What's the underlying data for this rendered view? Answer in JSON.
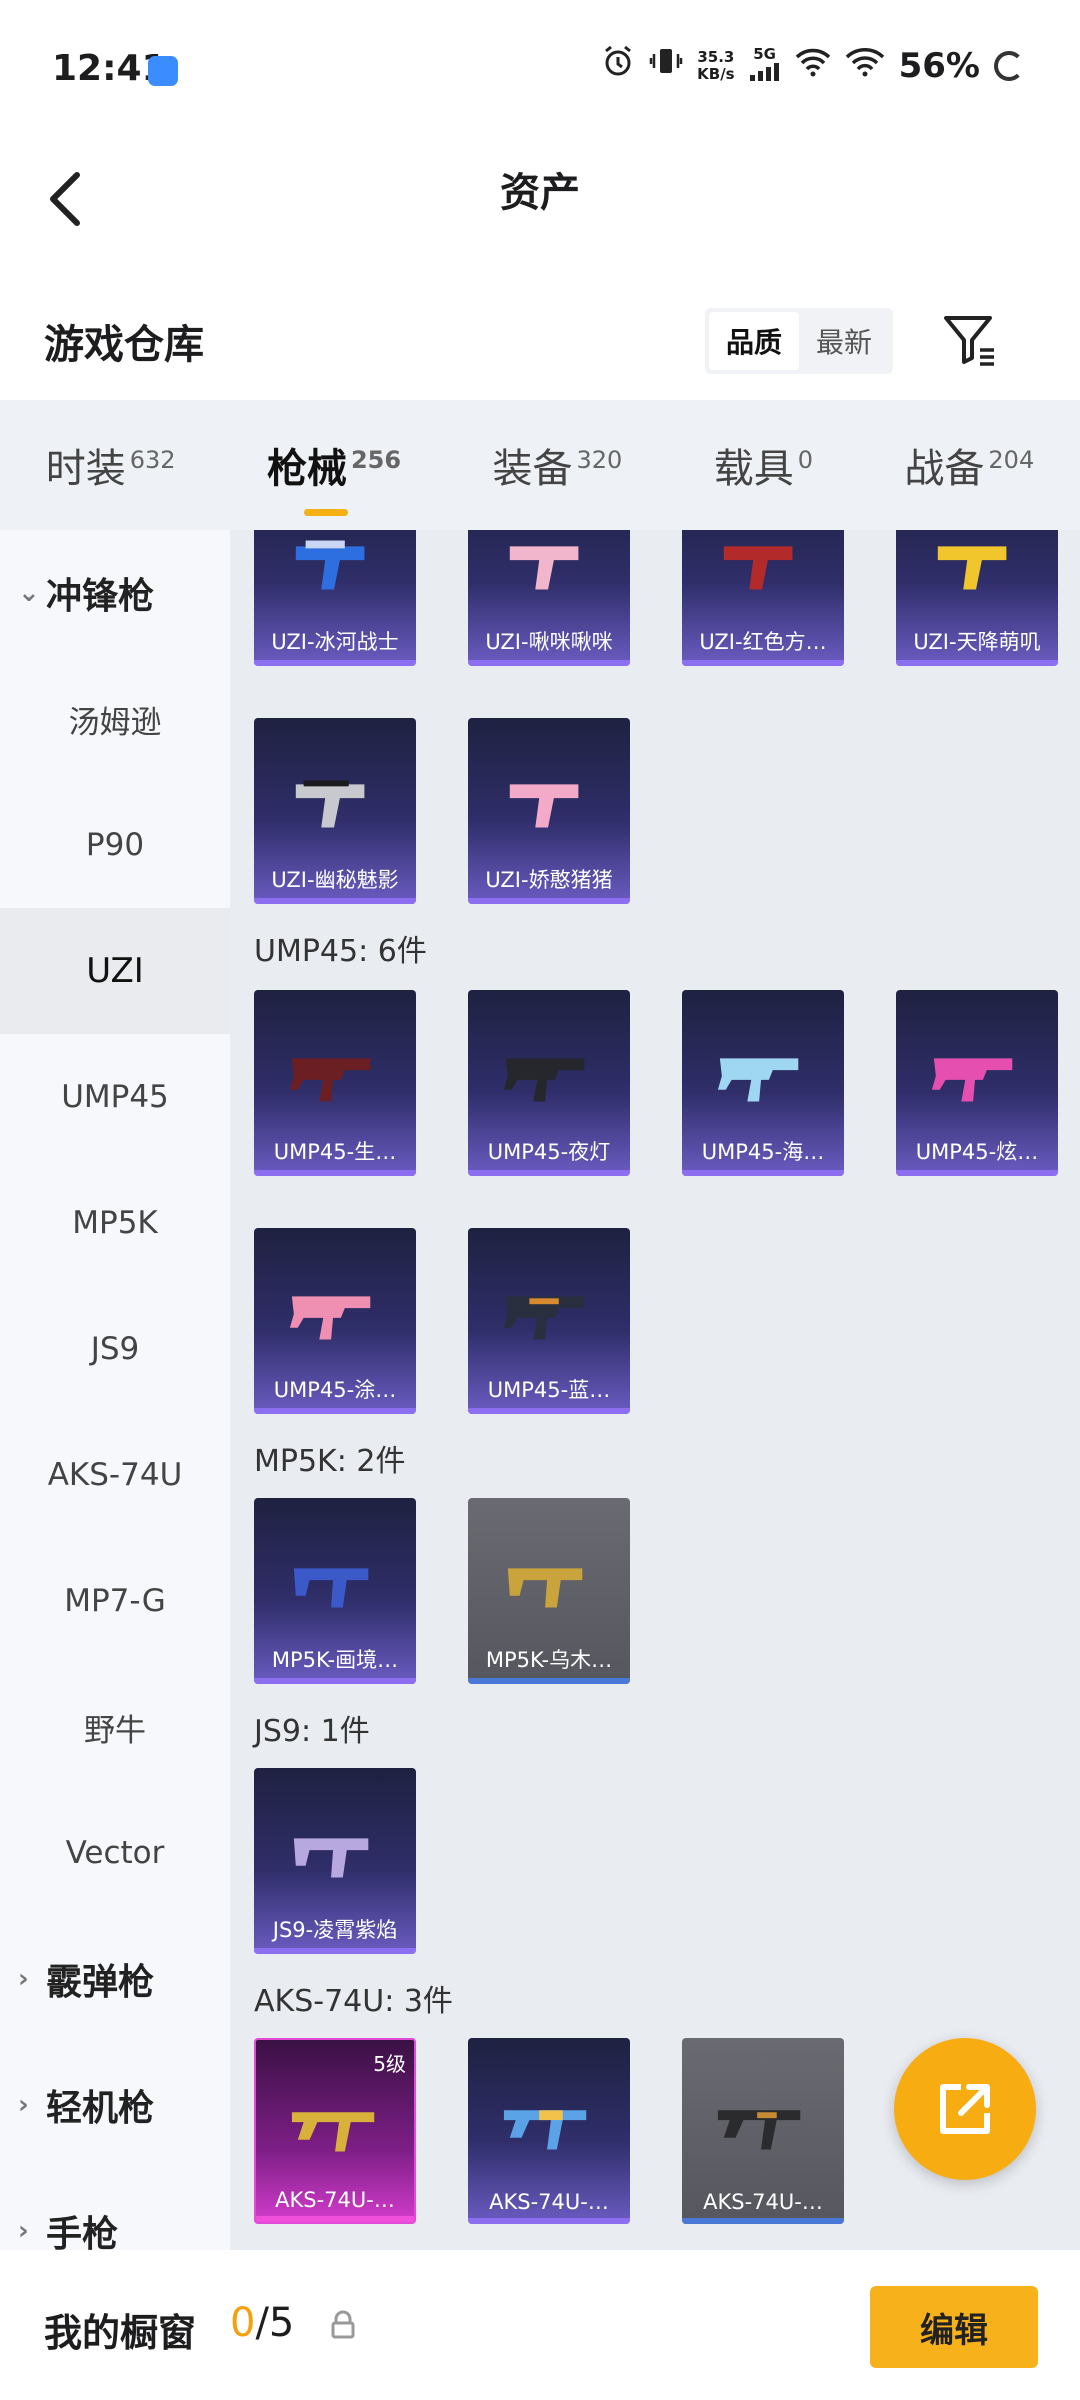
{
  "status_bar": {
    "time": "12:41",
    "net_speed_value": "35.3",
    "net_speed_unit": "KB/s",
    "network": "5G",
    "battery": "56%"
  },
  "nav": {
    "title": "资产"
  },
  "warehouse": {
    "title": "游戏仓库",
    "sort_quality": "品质",
    "sort_newest": "最新"
  },
  "category_tabs": [
    {
      "label": "时装",
      "count": "632"
    },
    {
      "label": "枪械",
      "count": "256"
    },
    {
      "label": "装备",
      "count": "320"
    },
    {
      "label": "载具",
      "count": "0"
    },
    {
      "label": "战备",
      "count": "204"
    }
  ],
  "sidebar": {
    "group_smg": "冲锋枪",
    "items": [
      "汤姆逊",
      "P90",
      "UZI",
      "UMP45",
      "MP5K",
      "JS9",
      "AKS-74U",
      "MP7-G",
      "野牛",
      "Vector"
    ],
    "group_shotgun": "霰弹枪",
    "group_lmg": "轻机枪",
    "group_pistol": "手枪"
  },
  "sections": {
    "uzi_cards": [
      "UZI-冰河战士",
      "UZI-啾咪啾咪",
      "UZI-红色方…",
      "UZI-天降萌叽",
      "UZI-幽秘魅影",
      "UZI-娇憨猪猪"
    ],
    "ump45_header": "UMP45: 6件",
    "ump45_cards": [
      "UMP45-生…",
      "UMP45-夜灯",
      "UMP45-海…",
      "UMP45-炫…",
      "UMP45-涂…",
      "UMP45-蓝…"
    ],
    "mp5k_header": "MP5K: 2件",
    "mp5k_cards": [
      "MP5K-画境…",
      "MP5K-乌木…"
    ],
    "js9_header": "JS9: 1件",
    "js9_cards": [
      "JS9-凌霄紫焰"
    ],
    "aks_header": "AKS-74U: 3件",
    "aks_cards": [
      "AKS-74U-…",
      "AKS-74U-…",
      "AKS-74U-…"
    ],
    "aks_badge": "5级"
  },
  "showcase": {
    "title": "我的橱窗",
    "current": "0",
    "total": "/5",
    "edit_label": "编辑"
  },
  "colors": {
    "accent": "#f7b21b",
    "card_purple": "#2f2e6a",
    "card_grey": "#5f6067",
    "card_pink": "#d23ccb"
  }
}
